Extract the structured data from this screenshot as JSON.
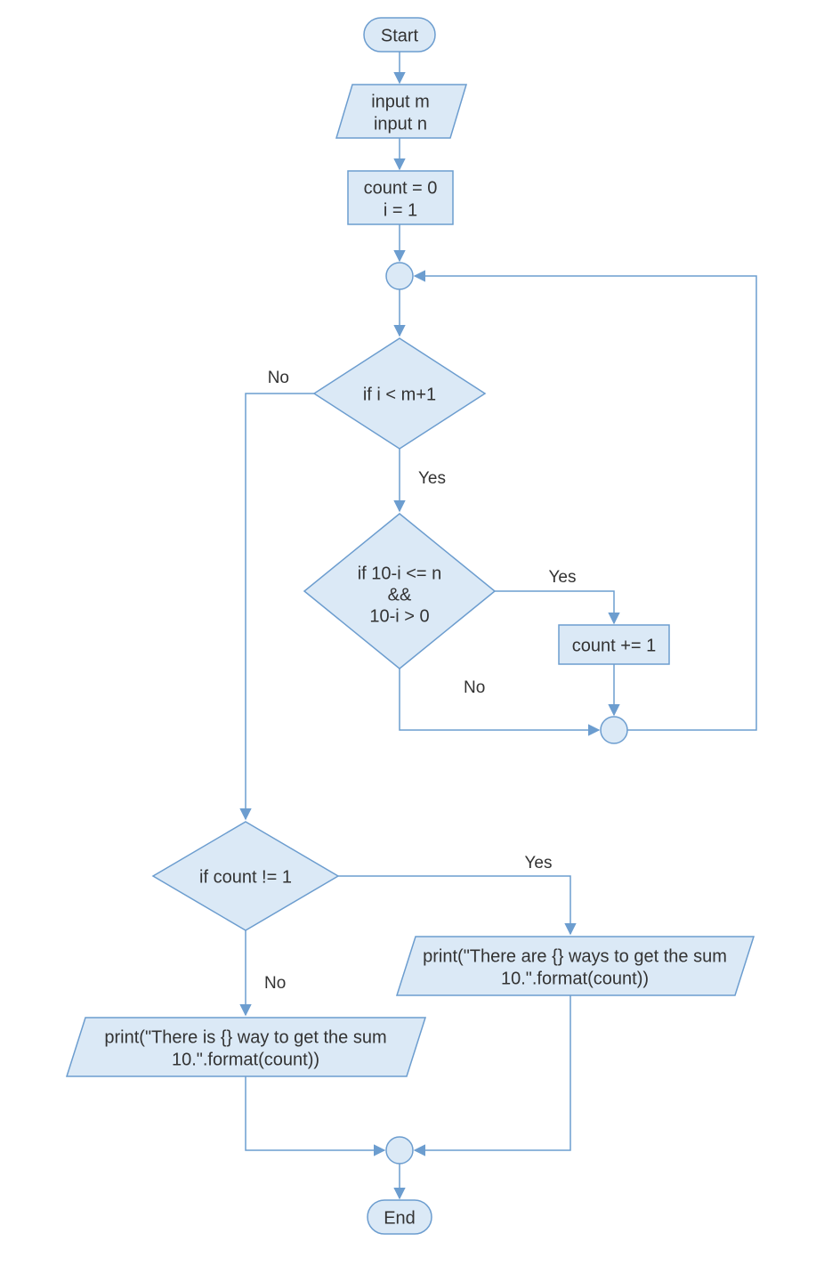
{
  "nodes": {
    "start": "Start",
    "end": "End",
    "input_line1": "input m",
    "input_line2": "input n",
    "init_line1": "count = 0",
    "init_line2": "i = 1",
    "loop_cond": "if i < m+1",
    "inner_cond_line1": "if 10-i <= n",
    "inner_cond_line2": "&&",
    "inner_cond_line3": "10-i > 0",
    "increment": "count += 1",
    "final_cond": "if count != 1",
    "print_plural_line1": "print(\"There are {} ways to get the sum",
    "print_plural_line2": "10.\".format(count))",
    "print_singular_line1": "print(\"There is {} way to get the sum",
    "print_singular_line2": "10.\".format(count))"
  },
  "labels": {
    "yes": "Yes",
    "no": "No"
  }
}
